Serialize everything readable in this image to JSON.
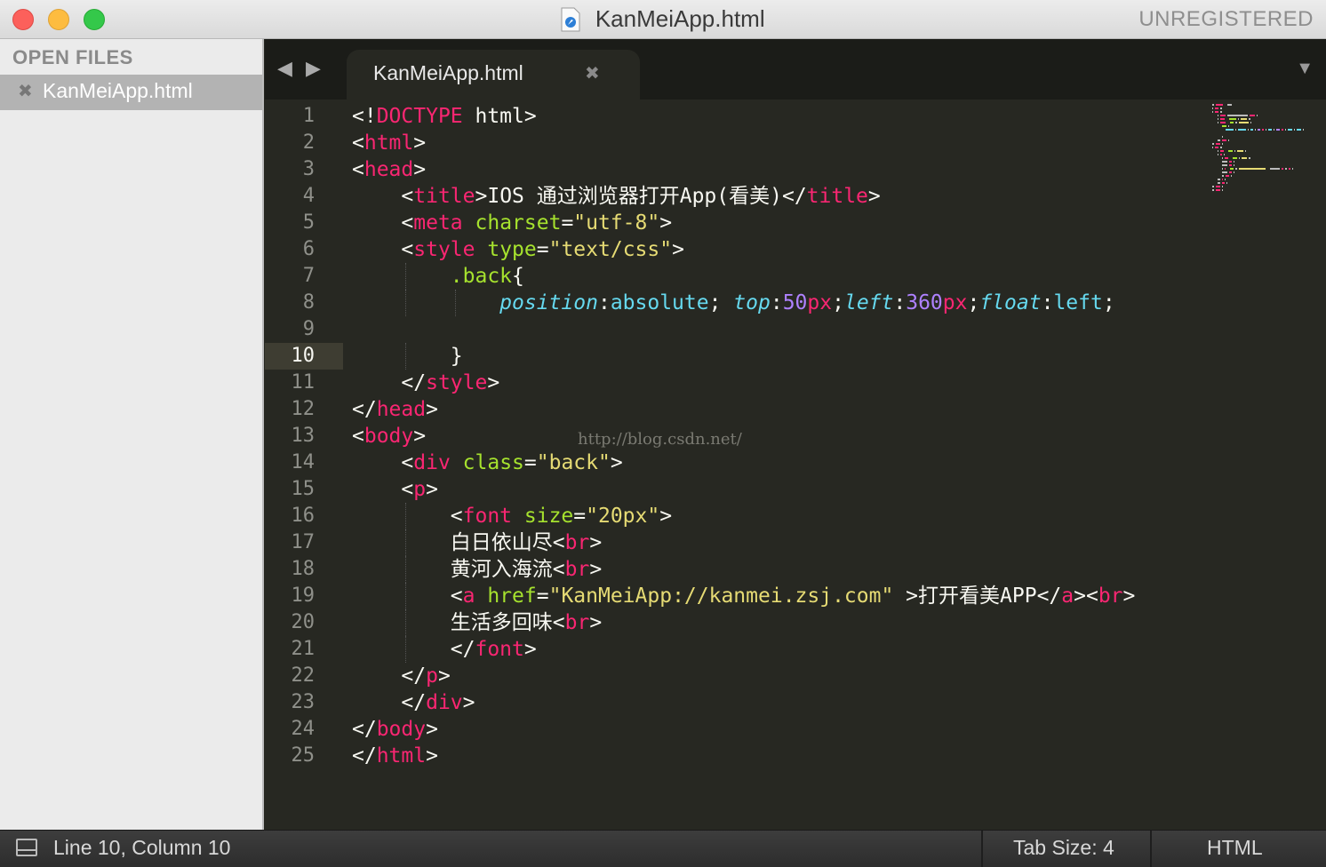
{
  "window": {
    "title": "KanMeiApp.html",
    "license_badge": "UNREGISTERED"
  },
  "sidebar": {
    "header": "OPEN FILES",
    "files": [
      {
        "close_glyph": "✖",
        "label": "KanMeiApp.html"
      }
    ]
  },
  "tabs": {
    "nav_back_glyph": "◀",
    "nav_forward_glyph": "▶",
    "active": {
      "label": "KanMeiApp.html",
      "close_glyph": "✖"
    },
    "menu_glyph": "▼"
  },
  "editor": {
    "current_line": 10,
    "watermark": "http://blog.csdn.net/",
    "line_numbers": [
      "1",
      "2",
      "3",
      "4",
      "5",
      "6",
      "7",
      "8",
      "9",
      "10",
      "11",
      "12",
      "13",
      "14",
      "15",
      "16",
      "17",
      "18",
      "19",
      "20",
      "21",
      "22",
      "23",
      "24",
      "25"
    ],
    "lines": [
      [
        [
          "p",
          "<!"
        ],
        [
          "t",
          "DOCTYPE"
        ],
        [
          "p",
          " html>"
        ]
      ],
      [
        [
          "p",
          "<"
        ],
        [
          "t",
          "html"
        ],
        [
          "p",
          ">"
        ]
      ],
      [
        [
          "p",
          "<"
        ],
        [
          "t",
          "head"
        ],
        [
          "p",
          ">"
        ]
      ],
      [
        [
          "p",
          "    <"
        ],
        [
          "t",
          "title"
        ],
        [
          "p",
          ">IOS 通过浏览器打开App(看美)</"
        ],
        [
          "t",
          "title"
        ],
        [
          "p",
          ">"
        ]
      ],
      [
        [
          "p",
          "    <"
        ],
        [
          "t",
          "meta"
        ],
        [
          "p",
          " "
        ],
        [
          "a",
          "charset"
        ],
        [
          "p",
          "="
        ],
        [
          "s",
          "\"utf-8\""
        ],
        [
          "p",
          ">"
        ]
      ],
      [
        [
          "p",
          "    <"
        ],
        [
          "t",
          "style"
        ],
        [
          "p",
          " "
        ],
        [
          "a",
          "type"
        ],
        [
          "p",
          "="
        ],
        [
          "s",
          "\"text/css\""
        ],
        [
          "p",
          ">"
        ]
      ],
      [
        [
          "p",
          "        "
        ],
        [
          "cls",
          ".back"
        ],
        [
          "p",
          "{"
        ]
      ],
      [
        [
          "p",
          "            "
        ],
        [
          "pn",
          "position"
        ],
        [
          "p",
          ":"
        ],
        [
          "pv",
          "absolute"
        ],
        [
          "p",
          "; "
        ],
        [
          "pn",
          "top"
        ],
        [
          "p",
          ":"
        ],
        [
          "nu",
          "50"
        ],
        [
          "u",
          "px"
        ],
        [
          "p",
          ";"
        ],
        [
          "pn",
          "left"
        ],
        [
          "p",
          ":"
        ],
        [
          "nu",
          "360"
        ],
        [
          "u",
          "px"
        ],
        [
          "p",
          ";"
        ],
        [
          "pn",
          "float"
        ],
        [
          "p",
          ":"
        ],
        [
          "pv",
          "left"
        ],
        [
          "p",
          ";"
        ]
      ],
      [
        [
          "p",
          ""
        ]
      ],
      [
        [
          "p",
          "        }"
        ]
      ],
      [
        [
          "p",
          "    </"
        ],
        [
          "t",
          "style"
        ],
        [
          "p",
          ">"
        ]
      ],
      [
        [
          "p",
          "</"
        ],
        [
          "t",
          "head"
        ],
        [
          "p",
          ">"
        ]
      ],
      [
        [
          "p",
          "<"
        ],
        [
          "t",
          "body"
        ],
        [
          "p",
          ">"
        ]
      ],
      [
        [
          "p",
          "    <"
        ],
        [
          "t",
          "div"
        ],
        [
          "p",
          " "
        ],
        [
          "a",
          "class"
        ],
        [
          "p",
          "="
        ],
        [
          "s",
          "\"back\""
        ],
        [
          "p",
          ">"
        ]
      ],
      [
        [
          "p",
          "    <"
        ],
        [
          "t",
          "p"
        ],
        [
          "p",
          ">"
        ]
      ],
      [
        [
          "p",
          "        <"
        ],
        [
          "t",
          "font"
        ],
        [
          "p",
          " "
        ],
        [
          "a",
          "size"
        ],
        [
          "p",
          "="
        ],
        [
          "s",
          "\"20px\""
        ],
        [
          "p",
          ">"
        ]
      ],
      [
        [
          "p",
          "        白日依山尽<"
        ],
        [
          "t",
          "br"
        ],
        [
          "p",
          ">"
        ]
      ],
      [
        [
          "p",
          "        黄河入海流<"
        ],
        [
          "t",
          "br"
        ],
        [
          "p",
          ">"
        ]
      ],
      [
        [
          "p",
          "        <"
        ],
        [
          "t",
          "a"
        ],
        [
          "p",
          " "
        ],
        [
          "a",
          "href"
        ],
        [
          "p",
          "="
        ],
        [
          "s",
          "\"KanMeiApp://kanmei.zsj.com\""
        ],
        [
          "p",
          " >打开看美APP</"
        ],
        [
          "t",
          "a"
        ],
        [
          "p",
          "><"
        ],
        [
          "t",
          "br"
        ],
        [
          "p",
          ">"
        ]
      ],
      [
        [
          "p",
          "        生活多回味<"
        ],
        [
          "t",
          "br"
        ],
        [
          "p",
          ">"
        ]
      ],
      [
        [
          "p",
          "        </"
        ],
        [
          "t",
          "font"
        ],
        [
          "p",
          ">"
        ]
      ],
      [
        [
          "p",
          "    </"
        ],
        [
          "t",
          "p"
        ],
        [
          "p",
          ">"
        ]
      ],
      [
        [
          "p",
          "    </"
        ],
        [
          "t",
          "div"
        ],
        [
          "p",
          ">"
        ]
      ],
      [
        [
          "p",
          "</"
        ],
        [
          "t",
          "body"
        ],
        [
          "p",
          ">"
        ]
      ],
      [
        [
          "p",
          "</"
        ],
        [
          "t",
          "html"
        ],
        [
          "p",
          ">"
        ]
      ]
    ]
  },
  "statusbar": {
    "position": "Line 10, Column 10",
    "tab_size": "Tab Size: 4",
    "syntax": "HTML"
  },
  "colors": {
    "editor_bg": "#272822",
    "tag": "#f92672",
    "attribute": "#a6e22e",
    "string": "#e6db74",
    "css_property": "#66d9ef",
    "number": "#ae81ff"
  }
}
